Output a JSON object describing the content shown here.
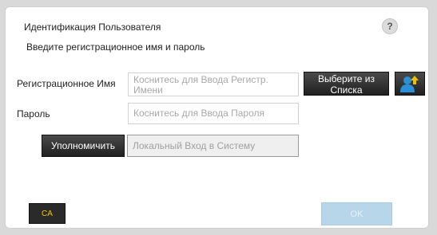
{
  "dialog": {
    "title": "Идентификация Пользователя",
    "help_glyph": "?",
    "subtitle": "Введите регистрационное имя и пароль"
  },
  "login_name": {
    "label": "Регистрационное Имя",
    "placeholder": "Коснитесь для Ввода Регистр. Имени",
    "select_button": "Выберите из Списка",
    "user_icon": "user-upload-icon"
  },
  "password": {
    "label": "Пароль",
    "placeholder": "Коснитесь для Ввода Пароля"
  },
  "authorize": {
    "button": "Уполномичить",
    "local_login_value": "Локальный Вход в Систему"
  },
  "footer": {
    "ca_label": "CA",
    "ok_label": "OK"
  },
  "colors": {
    "ca_text": "#f5c400",
    "ok_bg": "#b8d6ea",
    "user_icon_blue": "#2a8fd6",
    "user_icon_arrow": "#f0c000"
  }
}
